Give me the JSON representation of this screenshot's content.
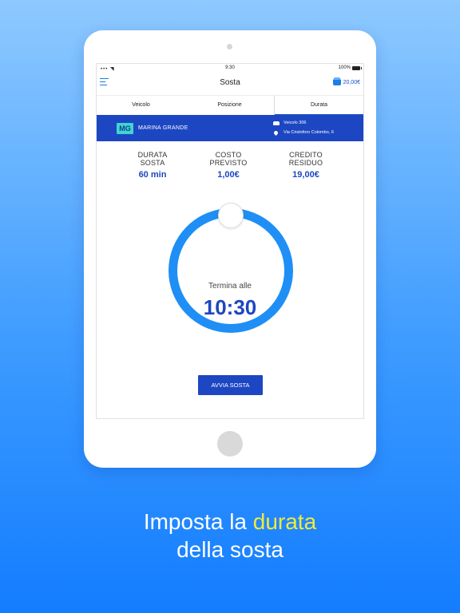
{
  "status_bar": {
    "left": "••• ◥",
    "time": "9:30",
    "battery": "100%"
  },
  "nav": {
    "title": "Sosta",
    "wallet_balance": "20,00€"
  },
  "tabs": [
    {
      "label": "Veicolo"
    },
    {
      "label": "Posizione"
    },
    {
      "label": "Durata"
    }
  ],
  "active_tab": "Durata",
  "zone": {
    "code": "MG",
    "name": "MARINA GRANDE",
    "vehicle": "Veicolo 306",
    "address": "Via Cristoforo Colombo, 6"
  },
  "stats": [
    {
      "label_line1": "DURATA",
      "label_line2": "SOSTA",
      "value": "60 min"
    },
    {
      "label_line1": "COSTO",
      "label_line2": "PREVISTO",
      "value": "1,00€"
    },
    {
      "label_line1": "CREDITO",
      "label_line2": "RESIDUO",
      "value": "19,00€"
    }
  ],
  "timer": {
    "label": "Termina alle",
    "time": "10:30"
  },
  "start_button": "AVVIA SOSTA",
  "caption": {
    "line1_prefix": "Imposta la ",
    "line1_highlight": "durata",
    "line2": "della sosta"
  },
  "colors": {
    "primary": "#1d47c2",
    "ring": "#1f8ff5",
    "zone_badge": "#3ed6ce",
    "highlight": "#f2ea3a"
  },
  "icons": {
    "menu": "menu-icon",
    "wallet": "wallet-icon",
    "car": "car-icon",
    "location": "location-pin-icon"
  }
}
